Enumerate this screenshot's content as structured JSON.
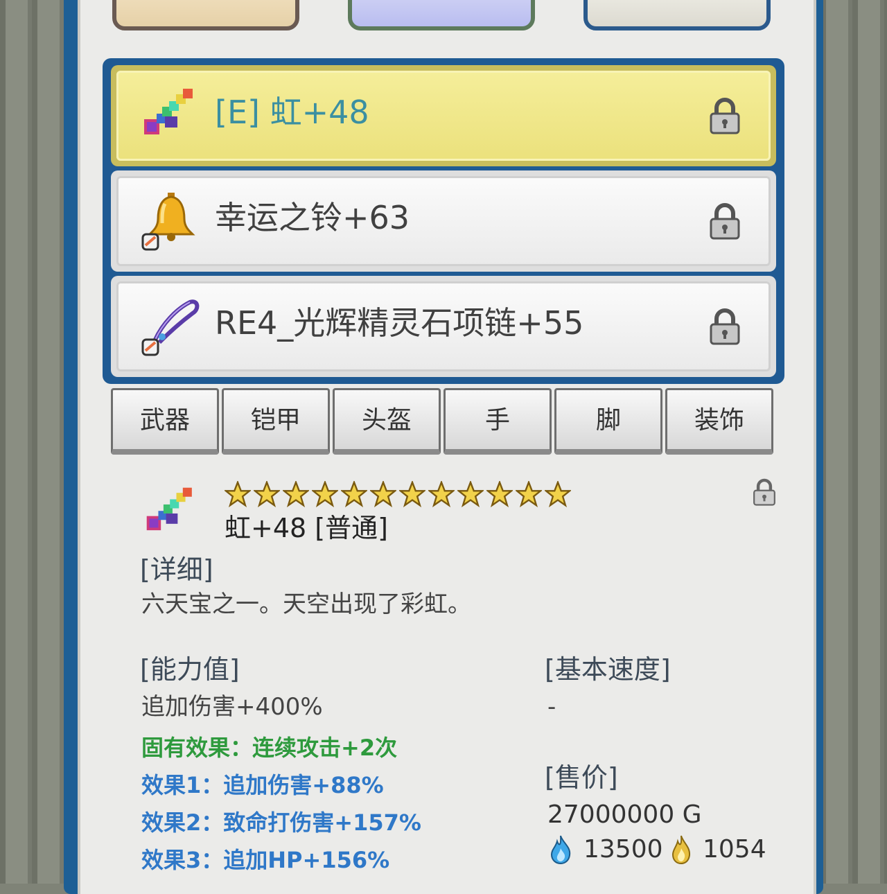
{
  "equipped": [
    {
      "name": "[E] 虹+48",
      "icon": "rainbow-gem-icon",
      "selected": true
    },
    {
      "name": "幸运之铃+63",
      "icon": "bell-icon",
      "selected": false
    },
    {
      "name": "RE4_光辉精灵石项链+55",
      "icon": "necklace-icon",
      "selected": false
    }
  ],
  "categories": [
    "武器",
    "铠甲",
    "头盔",
    "手",
    "脚",
    "装饰"
  ],
  "detail": {
    "title": "虹+48 [普通]",
    "stars": 12,
    "detail_header": "[详细]",
    "description": "六天宝之一。天空出现了彩虹。",
    "ability_header": "[能力值]",
    "ability": "追加伤害+400%",
    "inherent": "固有效果：连续攻击+2次",
    "effects": [
      "效果1：追加伤害+88%",
      "效果2：致命打伤害+157%",
      "效果3：追加HP+156%"
    ],
    "speed_header": "[基本速度]",
    "speed": "-",
    "price_header": "[售价]",
    "price": "27000000 G",
    "blue_flame": "13500",
    "gold_flame": "1054"
  },
  "colors": {
    "selected_text": "#3b8fa1",
    "green": "#2e9a3d",
    "blue": "#2f78c8",
    "frame": "#1d5f95"
  }
}
